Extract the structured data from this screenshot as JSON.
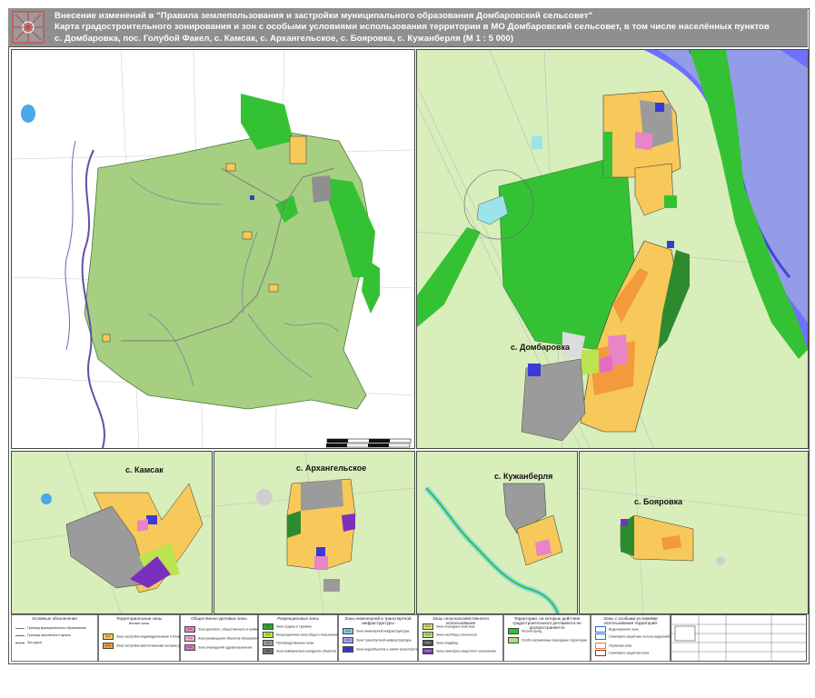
{
  "title": {
    "line1": "Внесение изменений в \"Правила землепользования и застройки муниципального образования Домбаровский сельсовет\"",
    "line2": "Карта градостроительного зонирования и зон с особыми условиями использования территории в МО Домбаровский сельсовет,  в том числе  населённых пунктов",
    "line3": "с. Домбаровка, пос. Голубой Факел, с. Камсак, с. Архангельское, с. Бояровка, с. Кужанберля (М 1 : 5 000)"
  },
  "settlements": {
    "goluboy_fakel": "пос. Голубой Факел",
    "dombarovka": "с. Домбаровка",
    "kamsak": "с. Камсак",
    "arkhangelskoe": "с. Архангельское",
    "kuzhanberlya": "с. Кужанберля",
    "boyarovka": "с. Бояровка"
  },
  "legend": {
    "conventional": {
      "heading": "Условные обозначения",
      "items": [
        "Граница муниципального образования",
        "Граница населенного пункта",
        "Зоо дорог"
      ]
    },
    "territorial": {
      "heading": "Территориальные зоны",
      "sub": "Жилые зоны",
      "items": [
        {
          "code": "Ж-1",
          "text": "Зона застройки индивидуальными и блокированными жилыми домами",
          "color": "#f7c85a"
        },
        {
          "code": "Ж-2",
          "text": "Зона застройки малоэтажными жилыми домами (2-4 этажа)",
          "color": "#f29a3c"
        }
      ]
    },
    "public": {
      "heading": "Общественно-деловые зоны",
      "items": [
        {
          "code": "О-1",
          "text": "Зона делового, общественного и коммерческого назначения",
          "color": "#e884c8"
        },
        {
          "code": "О-2",
          "text": "Зона размещения объектов образовательного учреждения",
          "color": "#f3b0dc"
        },
        {
          "code": "О-3",
          "text": "Зона учреждений здравоохранения",
          "color": "#d67ac0"
        }
      ]
    },
    "recreation": {
      "heading": "Рекреационные зоны",
      "items": [
        {
          "code": "Р-1",
          "text": "Зона отдыха и туризма",
          "color": "#2fa82f"
        },
        {
          "code": "Р-2",
          "text": "Рекреационная зона общего пользования",
          "color": "#bde34f"
        },
        {
          "code": "П-1",
          "text": "Производственные зоны",
          "color": "#9b9b9b"
        },
        {
          "code": "П-2",
          "text": "Зона коммунально-складских объектов",
          "color": "#6e6e6e"
        }
      ]
    },
    "engineering": {
      "heading": "Зоны инженерной и транспортной инфраструктуры",
      "items": [
        {
          "code": "И-1",
          "text": "Зона инженерной инфраструктуры",
          "color": "#7ec8e8"
        },
        {
          "code": "И-2",
          "text": "Зона транспортной инфраструктуры",
          "color": "#a3a3ff"
        },
        {
          "code": "И-3",
          "text": "Зона водообъектов и земли транспортной инфраструктуры",
          "color": "#3a3ad6"
        }
      ]
    },
    "agricultural": {
      "heading": "Зоны сельскохозяйственного использования",
      "items": [
        {
          "code": "СХ-1",
          "text": "Зона огородных участков",
          "color": "#d6e56c"
        },
        {
          "code": "СХ-2",
          "text": "Зона пастбищ и сенокосов",
          "color": "#b7e07a"
        },
        {
          "code": "СН-1",
          "text": "Зона кладбищ",
          "color": "#4d4d4d"
        },
        {
          "code": "СН-2",
          "text": "Зона санитарно-защитного озеленения",
          "color": "#7b2fbf"
        }
      ]
    },
    "special": {
      "heading": "Территории, на которые действие градостроительного регламента не распространяется",
      "items": [
        {
          "text": "Лесной фонд",
          "color": "#34c234"
        },
        {
          "text": "Особо охраняемые природные территории",
          "color": "#a8e07a"
        }
      ]
    },
    "restricted": {
      "heading": "Зоны с особыми условиями использования территорий",
      "items": [
        "Водоохранная зона",
        "Санитарно-защитные полосы водоснабжения / земли",
        "Охранная зона",
        "Санитарно-защитная зона"
      ]
    }
  },
  "colors": {
    "background": "#d8eebb",
    "territory": "#a7cf82",
    "residential": "#f7c85a",
    "residential2": "#f29a3c",
    "forest": "#34c234",
    "industrial": "#9b9b9b",
    "water": "#7070ff",
    "lake": "#4aa8e8",
    "cemetery": "#7b2fbf"
  },
  "icons": [
    "compass-logo-icon"
  ]
}
